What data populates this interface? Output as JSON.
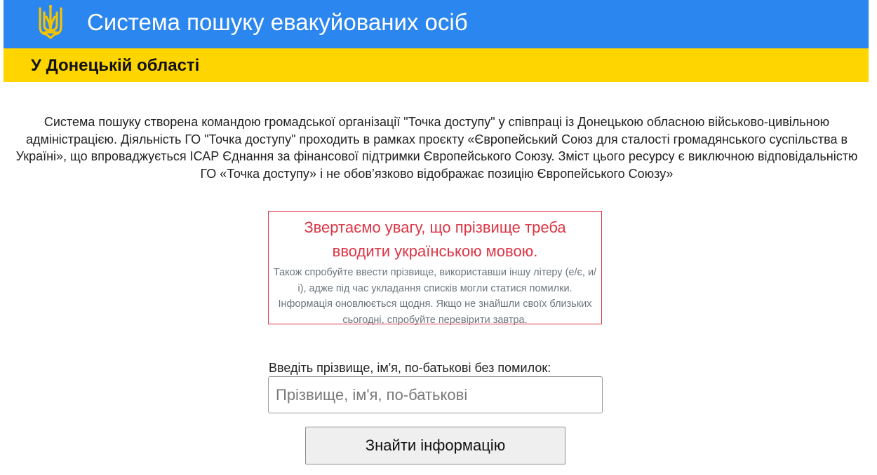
{
  "header": {
    "title": "Система пошуку евакуйованих осіб",
    "region": "У Донецькій області",
    "emblem_icon": "trident-icon",
    "colors": {
      "blue": "#2b86f0",
      "yellow": "#ffd500",
      "emblem": "#f5c400"
    }
  },
  "description": {
    "text": "Система пошуку створена командою громадської організації \"Точка доступу\" у співпраці із Донецькою обласною військово-цивільною адміністрацією. Діяльність ГО \"Точка доступу\" проходить в рамках проєкту «Європейський Союз для сталості громадянського суспільства в Україні», що впроваджується ІСАР Єднання за фінансової підтримки Європейського Союзу. Зміст цього ресурсу є виключною відповідальністю ГО «Точка доступу» і не обов’язково відображає позицію Європейського Союзу»"
  },
  "notice": {
    "main": "Звертаємо увагу, що прізвище треба вводити українською мовою.",
    "sub": "Також спробуйте ввести прізвище, використавши іншу літеру (е/є, и/і), адже під час укладання списків могли статися помилки. Інформація оновлюється щодня. Якщо не знайшли своїх близьких сьогодні, спробуйте перевірити завтра.",
    "colors": {
      "accent": "#dc3545",
      "muted": "#6c757d"
    }
  },
  "search": {
    "label": "Введіть прізвище, ім'я, по-батькові без помилок:",
    "placeholder": "Прізвище, ім'я, по-батькові",
    "value": "",
    "button_label": "Знайти інформацію"
  }
}
